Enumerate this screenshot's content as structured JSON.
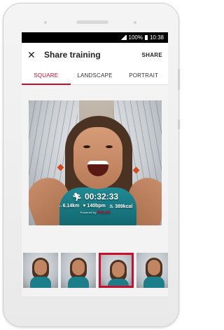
{
  "statusbar": {
    "battery": "100%",
    "time": "10:38"
  },
  "appbar": {
    "title": "Share training",
    "share_label": "SHARE"
  },
  "tabs": [
    {
      "label": "SQUARE",
      "active": true
    },
    {
      "label": "LANDSCAPE",
      "active": false
    },
    {
      "label": "PORTRAIT",
      "active": false
    }
  ],
  "summary": {
    "duration": "00:32:33",
    "distance": "6.14km",
    "heart_rate": "140bpm",
    "calories": "389kcal",
    "powered_by": "Powered by",
    "brand": "POLAR"
  },
  "thumbnails": [
    {
      "selected": false
    },
    {
      "selected": false
    },
    {
      "selected": true
    },
    {
      "selected": false
    }
  ],
  "colors": {
    "accent": "#c8102e",
    "statusbar": "#000000",
    "shirt": "#1f8a94"
  },
  "icons": [
    "close-icon",
    "signal-icon",
    "battery-icon",
    "running-icon",
    "distance-icon",
    "heart-icon",
    "flame-icon"
  ]
}
